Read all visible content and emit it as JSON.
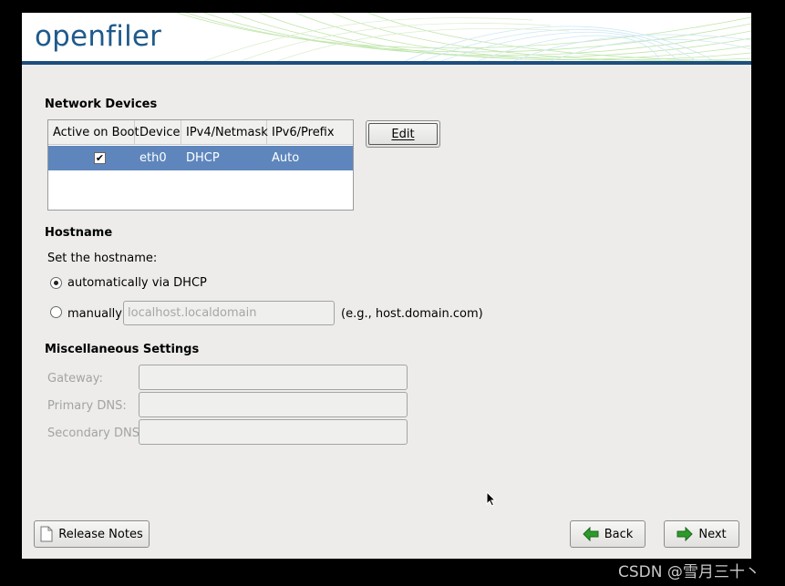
{
  "banner": {
    "logo_text": "openfiler"
  },
  "network_devices": {
    "title": "Network Devices",
    "columns": [
      "Active on Boot",
      "Device",
      "IPv4/Netmask",
      "IPv6/Prefix"
    ],
    "rows": [
      {
        "active_on_boot": true,
        "device": "eth0",
        "ipv4": "DHCP",
        "ipv6": "Auto"
      }
    ],
    "edit_label": "Edit"
  },
  "hostname": {
    "title": "Hostname",
    "prompt": "Set the hostname:",
    "auto_label": "automatically via DHCP",
    "manual_label": "manually",
    "manual_placeholder": "localhost.localdomain",
    "example": "(e.g., host.domain.com)",
    "selected": "automatically via DHCP"
  },
  "misc": {
    "title": "Miscellaneous Settings",
    "gateway_label": "Gateway:",
    "primary_dns_label": "Primary DNS:",
    "secondary_dns_label": "Secondary DNS:"
  },
  "footer": {
    "release_notes_label": "Release Notes",
    "back_label": "Back",
    "next_label": "Next"
  },
  "watermark": "CSDN @雪月三十丶",
  "colors": {
    "selection": "#5e86bd",
    "brand": "#1f5a8c",
    "arrow_green": "#2e9a2a"
  }
}
